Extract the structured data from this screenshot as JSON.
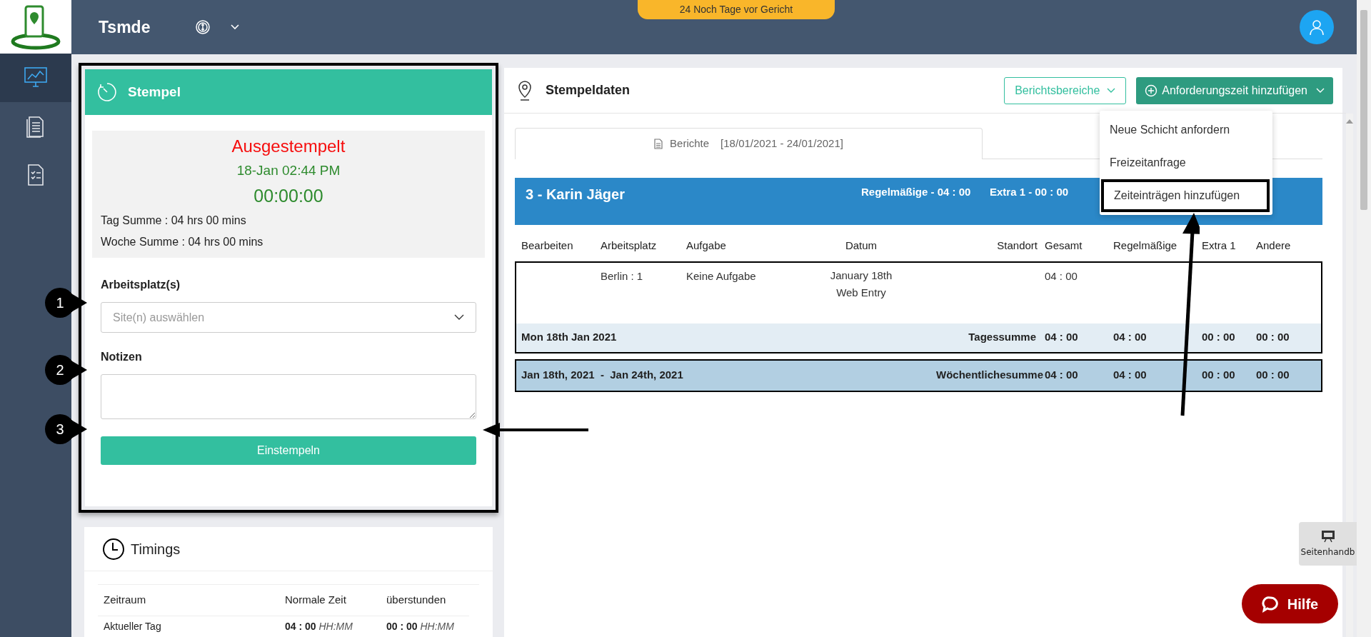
{
  "header": {
    "brand": "Tsmde",
    "notice": "24 Noch Tage vor Gericht"
  },
  "sidebar": {
    "items": [
      {
        "kind": "dashboard",
        "selected": true
      },
      {
        "kind": "reports",
        "selected": false
      },
      {
        "kind": "checklist",
        "selected": false
      }
    ]
  },
  "stempel": {
    "title": "Stempel",
    "status": "Ausgestempelt",
    "date": "18-Jan 02:44 PM",
    "timer": "00:00:00",
    "day_total": "Tag Summe : 04 hrs 00 mins",
    "week_total": "Woche Summe : 04 hrs 00 mins",
    "site_label": "Arbeitsplatz(s)",
    "site_placeholder": "Site(n) auswählen",
    "notes_label": "Notizen",
    "button": "Einstempeln"
  },
  "timings": {
    "title": "Timings",
    "columns": [
      "Zeitraum",
      "Normale Zeit",
      "überstunden"
    ],
    "rows": [
      {
        "period": "Aktueller Tag",
        "normal": "04 : 00",
        "normal_unit": "HH:MM",
        "overtime": "00 : 00",
        "overtime_unit": "HH:MM"
      }
    ]
  },
  "stempeldaten": {
    "title": "Stempeldaten",
    "filter_button": "Berichtsbereiche",
    "add_button": "Anforderungszeit hinzufügen",
    "menu": [
      {
        "label": "Neue Schicht anfordern",
        "selected": false
      },
      {
        "label": "Freizeitanfrage",
        "selected": false
      },
      {
        "label": "Zeiteinträgen hinzufügen",
        "selected": true
      }
    ],
    "tab": {
      "label": "Berichte",
      "range": "[18/01/2021 - 24/01/2021]"
    },
    "employee": {
      "name": "3 - Karin Jäger",
      "regular": "Regelmäßige - 04 : 00",
      "extra": "Extra 1 - 00 : 00"
    },
    "columns": [
      "Bearbeiten",
      "Arbeitsplatz",
      "Aufgabe",
      "Datum",
      "Standort",
      "Gesamt",
      "Regelmäßige",
      "Extra 1",
      "Andere"
    ],
    "entries": [
      {
        "site": "Berlin : 1",
        "task": "Keine Aufgabe",
        "date": "January 18th",
        "source": "Web Entry",
        "total": "04 : 00"
      }
    ],
    "day_total": {
      "label": "Mon 18th Jan 2021",
      "caption": "Tagessumme",
      "total": "04 : 00",
      "regular": "04 : 00",
      "extra": "00 : 00",
      "other": "00 : 00"
    },
    "week_total": {
      "label": "Jan 18th, 2021  -  Jan 24th, 2021",
      "caption": "Wöchentlichesumme",
      "total": "04 : 00",
      "regular": "04 : 00",
      "extra": "00 : 00",
      "other": "00 : 00"
    }
  },
  "callouts": [
    "1",
    "2",
    "3"
  ],
  "guide": {
    "label": "Seitenhandb"
  },
  "help": {
    "label": "Hilfe"
  }
}
